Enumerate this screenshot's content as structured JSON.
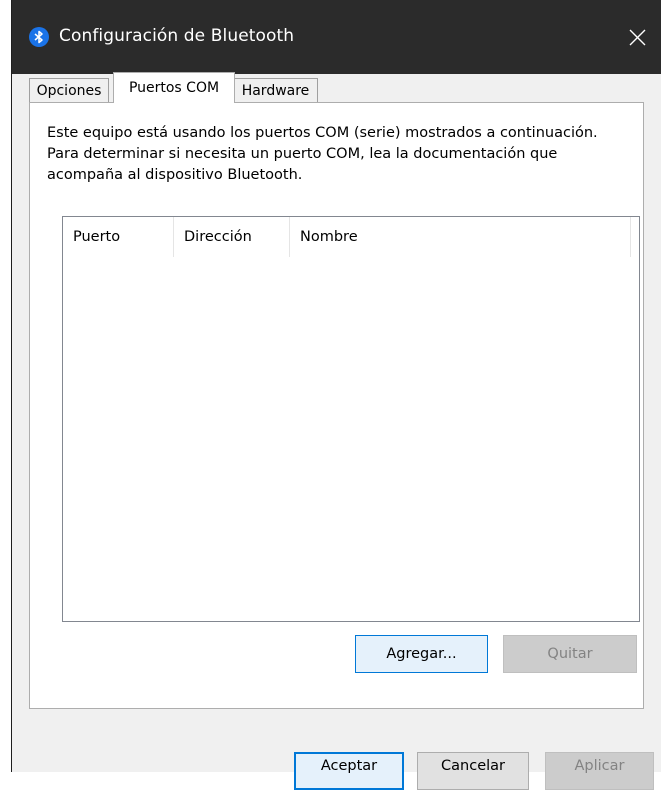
{
  "window": {
    "title": "Configuración de Bluetooth",
    "icon": "bluetooth-icon",
    "close_icon": "close-icon"
  },
  "tabs": [
    {
      "label": "Opciones",
      "active": false
    },
    {
      "label": "Puertos COM",
      "active": true
    },
    {
      "label": "Hardware",
      "active": false
    }
  ],
  "panel": {
    "description": "Este equipo está usando los puertos COM (serie) mostrados a continuación. Para determinar si necesita un puerto COM, lea la documentación que acompaña al dispositivo Bluetooth.",
    "columns": [
      "Puerto",
      "Dirección",
      "Nombre"
    ],
    "rows": [],
    "add_label": "Agregar...",
    "remove_label": "Quitar"
  },
  "footer": {
    "ok_label": "Aceptar",
    "cancel_label": "Cancelar",
    "apply_label": "Aplicar"
  },
  "colors": {
    "titlebar": "#2b2b2b",
    "accent": "#0078d7",
    "bluetooth": "#1a73e8"
  }
}
